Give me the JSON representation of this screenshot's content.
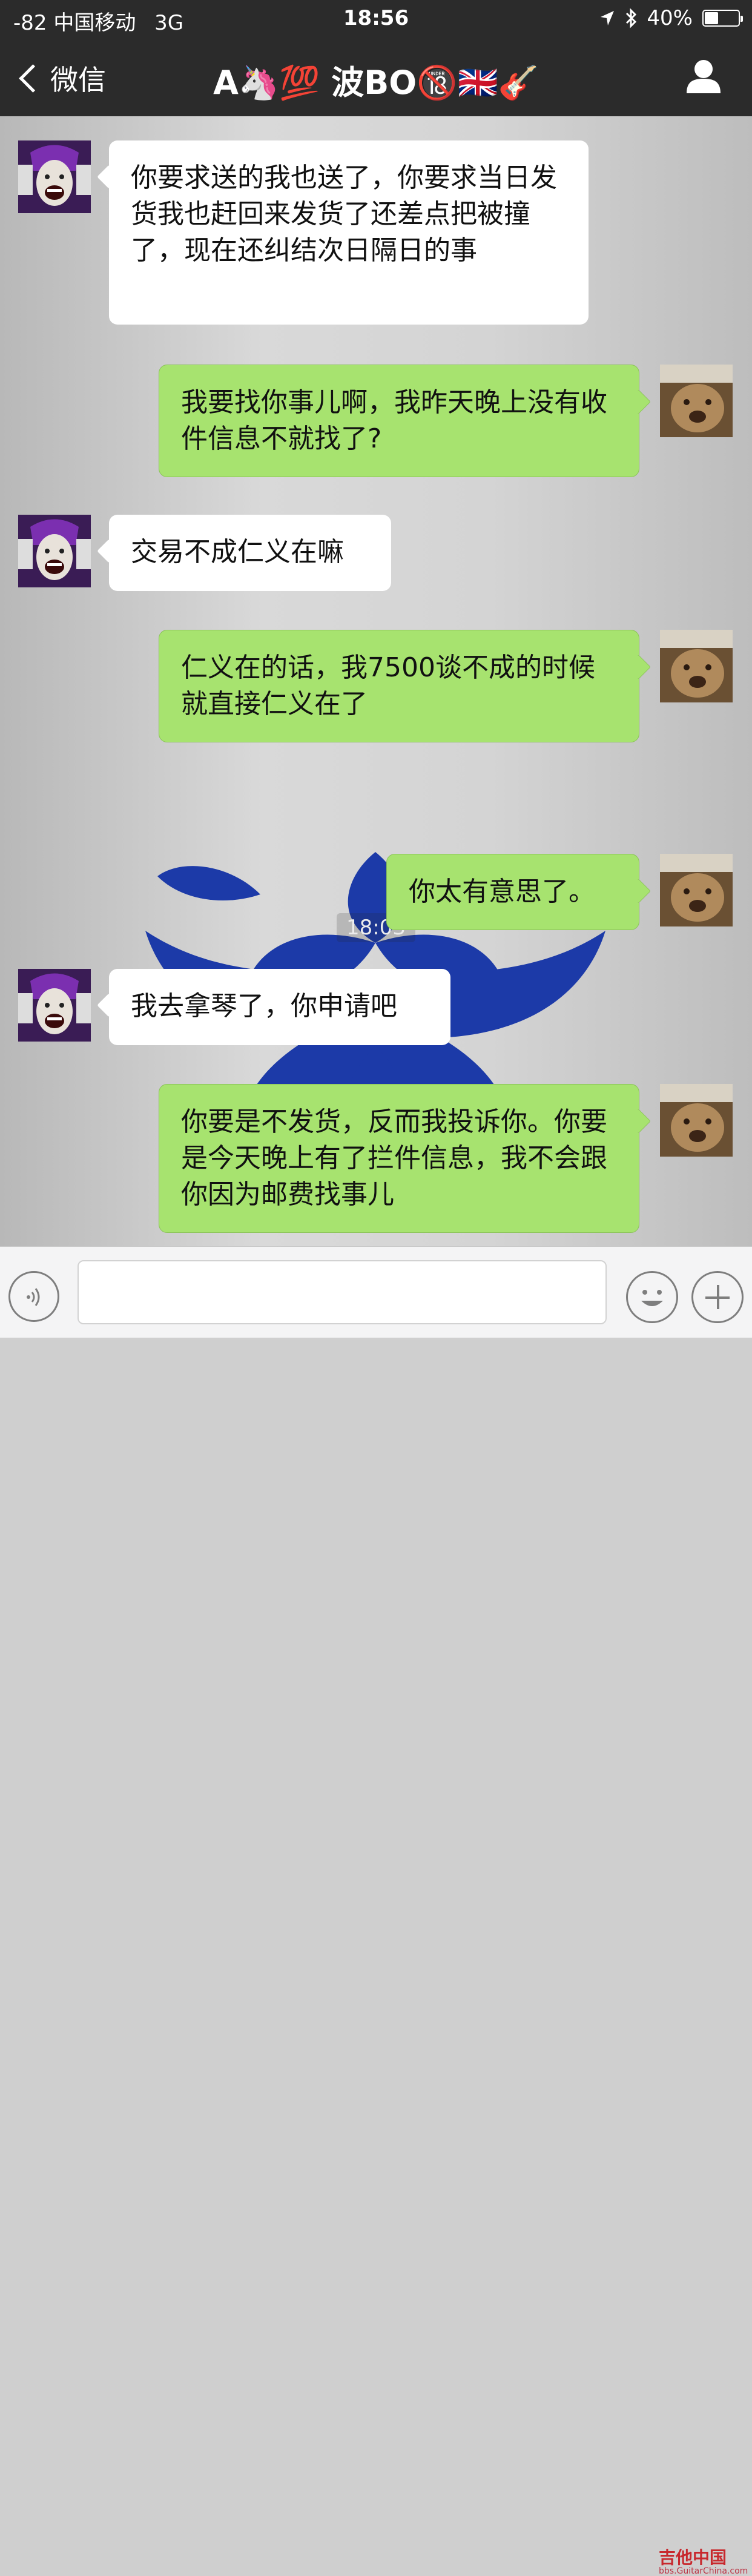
{
  "status_bar": {
    "carrier": "-82 中国移动",
    "network": "3G",
    "time": "18:56",
    "battery": "40%",
    "battery_level": 0.4
  },
  "nav": {
    "back_label": "微信",
    "title": "A🦄💯 波BO🔞🇬🇧🎸"
  },
  "messages": [
    {
      "side": "left",
      "text": "你要求送的我也送了，你要求当日发货我也赶回来发货了还差点把被撞了，现在还纠结次日隔日的事"
    },
    {
      "side": "right",
      "text": "我要找你事儿啊，我昨天晚上没有收件信息不就找了?"
    },
    {
      "side": "left",
      "text": "交易不成仁义在嘛"
    },
    {
      "side": "right",
      "text": "仁义在的话，我7500谈不成的时候就直接仁义在了"
    },
    {
      "side": "right",
      "text": "你太有意思了。"
    },
    {
      "side": "left",
      "text": "我去拿琴了，你申请吧"
    },
    {
      "side": "right",
      "text": "你要是不发货，反而我投诉你。你要是今天晚上有了拦件信息，我不会跟你因为邮费找事儿"
    }
  ],
  "timestamp": "18:03",
  "watermark": {
    "brand": "吉他中国",
    "site": "bbs.GuitarChina.com"
  },
  "colors": {
    "bar": "#2b2b2b",
    "bubble_right": "#a7e36f",
    "bubble_left": "#ffffff",
    "lotus": "#1c3aa8"
  }
}
